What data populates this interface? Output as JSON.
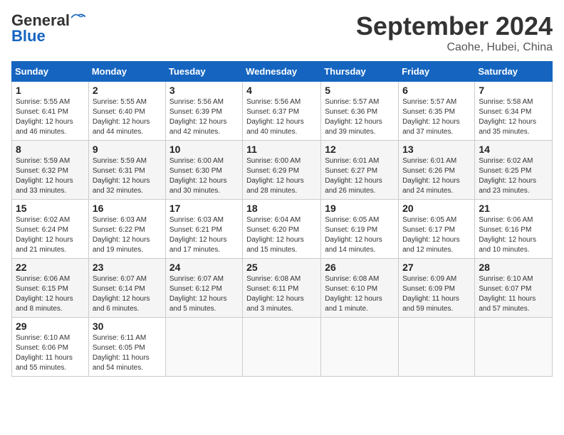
{
  "header": {
    "logo_line1": "General",
    "logo_line2": "Blue",
    "month": "September 2024",
    "location": "Caohe, Hubei, China"
  },
  "weekdays": [
    "Sunday",
    "Monday",
    "Tuesday",
    "Wednesday",
    "Thursday",
    "Friday",
    "Saturday"
  ],
  "weeks": [
    [
      {
        "day": "1",
        "sunrise": "5:55 AM",
        "sunset": "6:41 PM",
        "daylight": "12 hours and 46 minutes."
      },
      {
        "day": "2",
        "sunrise": "5:55 AM",
        "sunset": "6:40 PM",
        "daylight": "12 hours and 44 minutes."
      },
      {
        "day": "3",
        "sunrise": "5:56 AM",
        "sunset": "6:39 PM",
        "daylight": "12 hours and 42 minutes."
      },
      {
        "day": "4",
        "sunrise": "5:56 AM",
        "sunset": "6:37 PM",
        "daylight": "12 hours and 40 minutes."
      },
      {
        "day": "5",
        "sunrise": "5:57 AM",
        "sunset": "6:36 PM",
        "daylight": "12 hours and 39 minutes."
      },
      {
        "day": "6",
        "sunrise": "5:57 AM",
        "sunset": "6:35 PM",
        "daylight": "12 hours and 37 minutes."
      },
      {
        "day": "7",
        "sunrise": "5:58 AM",
        "sunset": "6:34 PM",
        "daylight": "12 hours and 35 minutes."
      }
    ],
    [
      {
        "day": "8",
        "sunrise": "5:59 AM",
        "sunset": "6:32 PM",
        "daylight": "12 hours and 33 minutes."
      },
      {
        "day": "9",
        "sunrise": "5:59 AM",
        "sunset": "6:31 PM",
        "daylight": "12 hours and 32 minutes."
      },
      {
        "day": "10",
        "sunrise": "6:00 AM",
        "sunset": "6:30 PM",
        "daylight": "12 hours and 30 minutes."
      },
      {
        "day": "11",
        "sunrise": "6:00 AM",
        "sunset": "6:29 PM",
        "daylight": "12 hours and 28 minutes."
      },
      {
        "day": "12",
        "sunrise": "6:01 AM",
        "sunset": "6:27 PM",
        "daylight": "12 hours and 26 minutes."
      },
      {
        "day": "13",
        "sunrise": "6:01 AM",
        "sunset": "6:26 PM",
        "daylight": "12 hours and 24 minutes."
      },
      {
        "day": "14",
        "sunrise": "6:02 AM",
        "sunset": "6:25 PM",
        "daylight": "12 hours and 23 minutes."
      }
    ],
    [
      {
        "day": "15",
        "sunrise": "6:02 AM",
        "sunset": "6:24 PM",
        "daylight": "12 hours and 21 minutes."
      },
      {
        "day": "16",
        "sunrise": "6:03 AM",
        "sunset": "6:22 PM",
        "daylight": "12 hours and 19 minutes."
      },
      {
        "day": "17",
        "sunrise": "6:03 AM",
        "sunset": "6:21 PM",
        "daylight": "12 hours and 17 minutes."
      },
      {
        "day": "18",
        "sunrise": "6:04 AM",
        "sunset": "6:20 PM",
        "daylight": "12 hours and 15 minutes."
      },
      {
        "day": "19",
        "sunrise": "6:05 AM",
        "sunset": "6:19 PM",
        "daylight": "12 hours and 14 minutes."
      },
      {
        "day": "20",
        "sunrise": "6:05 AM",
        "sunset": "6:17 PM",
        "daylight": "12 hours and 12 minutes."
      },
      {
        "day": "21",
        "sunrise": "6:06 AM",
        "sunset": "6:16 PM",
        "daylight": "12 hours and 10 minutes."
      }
    ],
    [
      {
        "day": "22",
        "sunrise": "6:06 AM",
        "sunset": "6:15 PM",
        "daylight": "12 hours and 8 minutes."
      },
      {
        "day": "23",
        "sunrise": "6:07 AM",
        "sunset": "6:14 PM",
        "daylight": "12 hours and 6 minutes."
      },
      {
        "day": "24",
        "sunrise": "6:07 AM",
        "sunset": "6:12 PM",
        "daylight": "12 hours and 5 minutes."
      },
      {
        "day": "25",
        "sunrise": "6:08 AM",
        "sunset": "6:11 PM",
        "daylight": "12 hours and 3 minutes."
      },
      {
        "day": "26",
        "sunrise": "6:08 AM",
        "sunset": "6:10 PM",
        "daylight": "12 hours and 1 minute."
      },
      {
        "day": "27",
        "sunrise": "6:09 AM",
        "sunset": "6:09 PM",
        "daylight": "11 hours and 59 minutes."
      },
      {
        "day": "28",
        "sunrise": "6:10 AM",
        "sunset": "6:07 PM",
        "daylight": "11 hours and 57 minutes."
      }
    ],
    [
      {
        "day": "29",
        "sunrise": "6:10 AM",
        "sunset": "6:06 PM",
        "daylight": "11 hours and 55 minutes."
      },
      {
        "day": "30",
        "sunrise": "6:11 AM",
        "sunset": "6:05 PM",
        "daylight": "11 hours and 54 minutes."
      },
      null,
      null,
      null,
      null,
      null
    ]
  ]
}
